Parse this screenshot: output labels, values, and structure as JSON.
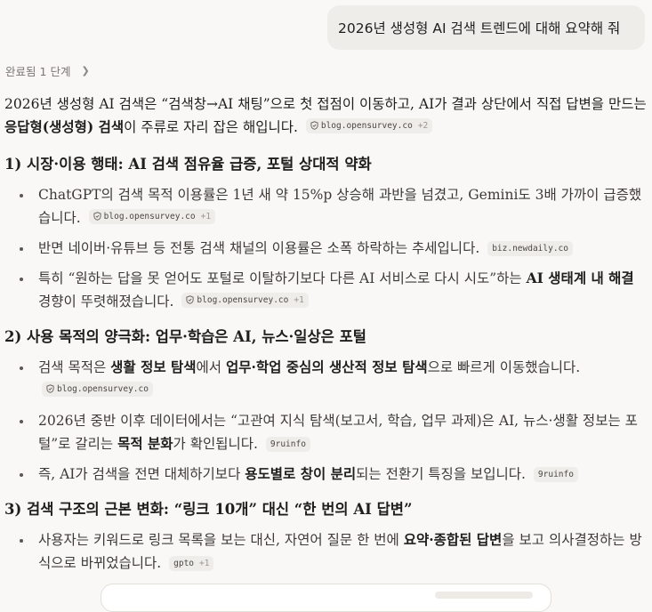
{
  "user_message": "2026년 생성형 AI 검색 트렌드에 대해 요약해 줘",
  "status": {
    "label": "완료됨",
    "steps": "1 단계"
  },
  "intro": {
    "t1": "2026년 생성형 AI 검색은 “검색창→AI 채팅”으로 첫 접점이 이동하고, AI가 결과 상단에서 직접 답변을 만드는 ",
    "b1": "응답형(생성형) 검색",
    "t2": "이 주류로 자리 잡은 해입니다.",
    "chip": {
      "source": "blog.opensurvey.co",
      "more": "+2"
    }
  },
  "sections": [
    {
      "title": "1) 시장·이용 행태: AI 검색 점유율 급증, 포털 상대적 약화",
      "bullets": [
        {
          "t1": "ChatGPT의 검색 목적 이용률은 1년 새 약 15%p 상승해 과반을 넘겼고, Gemini도 3배 가까이 급증했습니다.",
          "chip": {
            "source": "blog.opensurvey.co",
            "more": "+1"
          }
        },
        {
          "t1": "반면 네이버·유튜브 등 전통 검색 채널의 이용률은 소폭 하락하는 추세입니다.",
          "chip": {
            "source": "biz.newdaily.co",
            "more": ""
          }
        },
        {
          "t1": "특히 “원하는 답을 못 얻어도 포털로 이탈하기보다 다른 AI 서비스로 다시 시도”하는 ",
          "b1": "AI 생태계 내 해결",
          "t2": " 경향이 뚜렷해졌습니다.",
          "chip": {
            "source": "blog.opensurvey.co",
            "more": "+1"
          }
        }
      ]
    },
    {
      "title": "2) 사용 목적의 양극화: 업무·학습은 AI, 뉴스·일상은 포털",
      "bullets": [
        {
          "t1": "검색 목적은 ",
          "b1": "생활 정보 탐색",
          "t2": "에서 ",
          "b2": "업무·학업 중심의 생산적 정보 탐색",
          "t3": "으로 빠르게 이동했습니다.",
          "chip": {
            "source": "blog.opensurvey.co",
            "more": ""
          }
        },
        {
          "t1": "2026년 중반 이후 데이터에서는 “고관여 지식 탐색(보고서, 학습, 업무 과제)은 AI, 뉴스·생활 정보는 포털”로 갈리는 ",
          "b1": "목적 분화",
          "t2": "가 확인됩니다.",
          "chip": {
            "source": "9ruinfo",
            "more": ""
          }
        },
        {
          "t1": "즉, AI가 검색을 전면 대체하기보다 ",
          "b1": "용도별로 창이 분리",
          "t2": "되는 전환기 특징을 보입니다.",
          "chip": {
            "source": "9ruinfo",
            "more": ""
          }
        }
      ]
    },
    {
      "title": "3) 검색 구조의 근본 변화: “링크 10개” 대신 “한 번의 AI 답변”",
      "bullets": [
        {
          "t1": "사용자는 키워드로 링크 목록을 보는 대신, 자연어 질문 한 번에 ",
          "b1": "요약·종합된 답변",
          "t2": "을 보고 의사결정하는 방식으로 바뀌었습니다.",
          "chip": {
            "source": "gpto",
            "more": "+1"
          }
        }
      ]
    }
  ]
}
